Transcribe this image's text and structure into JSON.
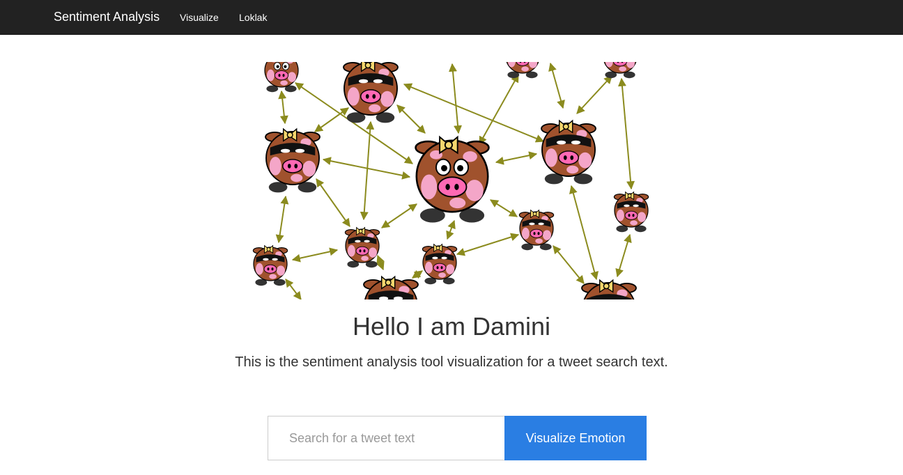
{
  "navbar": {
    "brand": "Sentiment Analysis",
    "links": [
      "Visualize",
      "Loklak"
    ],
    "background": "#222222"
  },
  "hero": {
    "illustration": "cow-network-illustration",
    "headline": "Hello I am Damini",
    "subtitle": "This is the sentiment analysis tool visualization for a tweet search text."
  },
  "search": {
    "placeholder": "Search for a tweet text",
    "value": "",
    "button_label": "Visualize Emotion",
    "button_color": "#2a7ee3"
  },
  "colors": {
    "cow_body": "#a0522d",
    "cow_spots": "#f4a6c8",
    "arrows": "#8b8b1e",
    "bow": "#f5d76e"
  }
}
